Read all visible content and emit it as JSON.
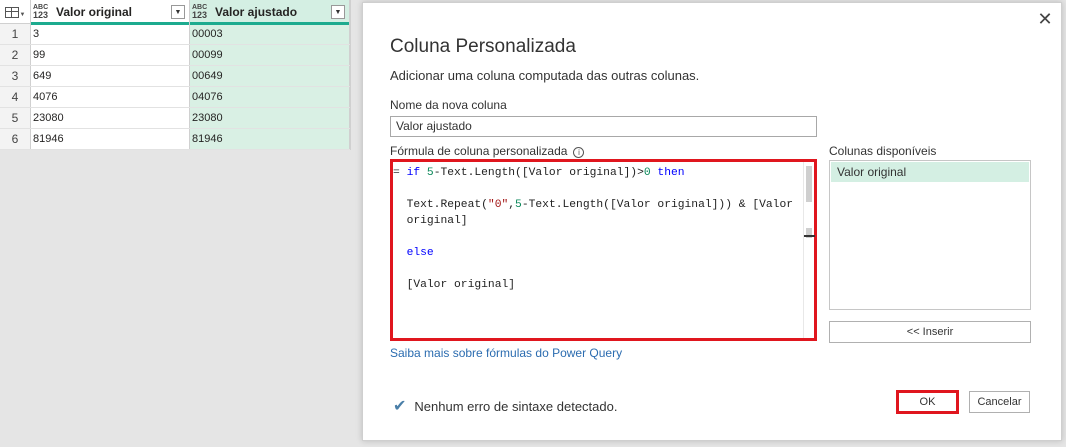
{
  "grid": {
    "columns": [
      {
        "type_top": "ABC",
        "type_bottom": "123",
        "title": "Valor original"
      },
      {
        "type_top": "ABC",
        "type_bottom": "123",
        "title": "Valor ajustado"
      }
    ],
    "rows": [
      {
        "n": "1",
        "a": "3",
        "b": "00003"
      },
      {
        "n": "2",
        "a": "99",
        "b": "00099"
      },
      {
        "n": "3",
        "a": "649",
        "b": "00649"
      },
      {
        "n": "4",
        "a": "4076",
        "b": "04076"
      },
      {
        "n": "5",
        "a": "23080",
        "b": "23080"
      },
      {
        "n": "6",
        "a": "81946",
        "b": "81946"
      }
    ]
  },
  "dialog": {
    "title": "Coluna Personalizada",
    "subtitle": "Adicionar uma coluna computada das outras colunas.",
    "name_label": "Nome da nova coluna",
    "name_value": "Valor ajustado",
    "formula_label": "Fórmula de coluna personalizada",
    "formula": {
      "l1_eq": "= ",
      "l1_if": "if",
      "l1_sp": " ",
      "l1_5": "5",
      "l1_mid": "-Text.Length([Valor original])>",
      "l1_0": "0",
      "l1_then": "then",
      "l3_a": "Text.Repeat(",
      "l3_str": "\"0\"",
      "l3_b": ",",
      "l3_5": "5",
      "l3_c": "-Text.Length([Valor original])) & [Valor",
      "l4": "original]",
      "l6_else": "else",
      "l8": "[Valor original]"
    },
    "available_label": "Colunas disponíveis",
    "available_columns": [
      "Valor original"
    ],
    "insert_label": "<< Inserir",
    "learn_link": "Saiba mais sobre fórmulas do Power Query",
    "status": "Nenhum erro de sintaxe detectado.",
    "ok_label": "OK",
    "cancel_label": "Cancelar"
  },
  "icons": {
    "close": "close-icon",
    "info": "info-icon",
    "check": "check-icon",
    "table": "table-icon"
  },
  "colors": {
    "accent_teal": "#1dab8f",
    "highlight_red": "#e0161e",
    "link_blue": "#2b6cb0"
  }
}
